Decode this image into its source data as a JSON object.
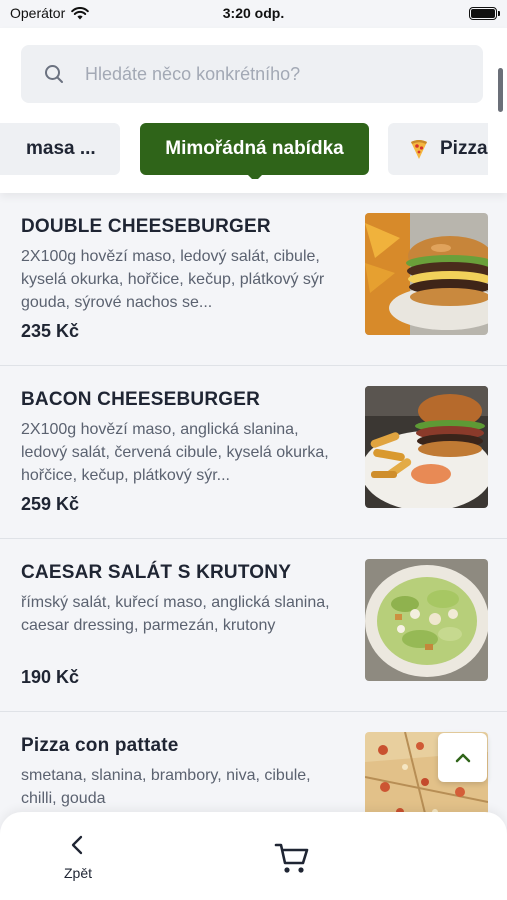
{
  "status_bar": {
    "carrier": "Operátor",
    "time": "3:20 odp."
  },
  "search": {
    "placeholder": "Hledáte něco konkrétního?",
    "value": ""
  },
  "categories": [
    {
      "label": "masa ...",
      "selected": false
    },
    {
      "label": "Mimořádná nabídka",
      "selected": true
    },
    {
      "label": "Pizza",
      "icon": "pizza-icon",
      "selected": false
    }
  ],
  "items": [
    {
      "title": "DOUBLE CHEESEBURGER",
      "description": "2X100g hovězí maso, ledový salát, cibule, kyselá okurka, hořčice, kečup, plátkový sýr gouda, sýrové nachos se...",
      "price": "235 Kč",
      "image": "cheeseburger-photo"
    },
    {
      "title": "BACON CHEESEBURGER",
      "description": "2X100g hovězí maso, anglická slanina, ledový salát, červená cibule, kyselá okurka, hořčice, kečup, plátkový sýr...",
      "price": "259 Kč",
      "image": "bacon-burger-photo"
    },
    {
      "title": "CAESAR SALÁT S KRUTONY",
      "description": "římský salát, kuřecí maso, anglická slanina, caesar dressing, parmezán, krutony",
      "price": "190 Kč",
      "image": "caesar-salad-photo"
    },
    {
      "title": "Pizza con pattate",
      "description": "smetana, slanina, brambory, niva, cibule, chilli, gouda",
      "price": "",
      "image": "pizza-photo"
    }
  ],
  "bottom_bar": {
    "back_label": "Zpět",
    "cart_icon": "cart-icon",
    "back_icon": "chevron-left-icon"
  },
  "colors": {
    "accent": "#2f6419",
    "background": "#f4f5f8",
    "text": "#1f2533",
    "muted": "#5b6270"
  }
}
